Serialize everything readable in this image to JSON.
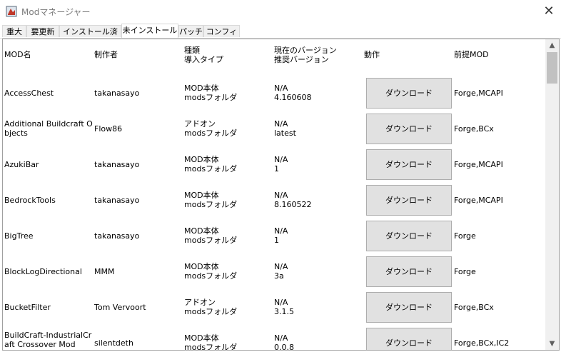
{
  "window": {
    "title": "Modマネージャー",
    "close_symbol": "✕"
  },
  "tabs": [
    {
      "label": "重大"
    },
    {
      "label": "要更新"
    },
    {
      "label": "インストール済み"
    },
    {
      "label": "未インストール",
      "active": true
    },
    {
      "label": "パッチ"
    },
    {
      "label": "コンフィグ"
    }
  ],
  "table": {
    "headers": {
      "name": "MOD名",
      "author": "制作者",
      "kind_line1": "種類",
      "kind_line2": "導入タイプ",
      "version_line1": "現在のバージョン",
      "version_line2": "推奨バージョン",
      "action": "動作",
      "prereq": "前提MOD"
    },
    "rows": [
      {
        "name": "AccessChest",
        "author": "takanasayo",
        "kind": "MOD本体",
        "install": "modsフォルダ",
        "current": "N/A",
        "recommended": "4.160608",
        "button": "ダウンロード",
        "prereq": "Forge,MCAPI"
      },
      {
        "name": "Additional Buildcraft Objects",
        "author": "Flow86",
        "kind": "アドオン",
        "install": "modsフォルダ",
        "current": "N/A",
        "recommended": "latest",
        "button": "ダウンロード",
        "prereq": "Forge,BCx"
      },
      {
        "name": "AzukiBar",
        "author": "takanasayo",
        "kind": "MOD本体",
        "install": "modsフォルダ",
        "current": "N/A",
        "recommended": "1",
        "button": "ダウンロード",
        "prereq": "Forge,MCAPI"
      },
      {
        "name": "BedrockTools",
        "author": "takanasayo",
        "kind": "MOD本体",
        "install": "modsフォルダ",
        "current": "N/A",
        "recommended": "8.160522",
        "button": "ダウンロード",
        "prereq": "Forge,MCAPI"
      },
      {
        "name": "BigTree",
        "author": "takanasayo",
        "kind": "MOD本体",
        "install": "modsフォルダ",
        "current": "N/A",
        "recommended": "1",
        "button": "ダウンロード",
        "prereq": "Forge"
      },
      {
        "name": "BlockLogDirectional",
        "author": "MMM",
        "kind": "MOD本体",
        "install": "modsフォルダ",
        "current": "N/A",
        "recommended": "3a",
        "button": "ダウンロード",
        "prereq": "Forge"
      },
      {
        "name": "BucketFilter",
        "author": "Tom Vervoort",
        "kind": "アドオン",
        "install": "modsフォルダ",
        "current": "N/A",
        "recommended": "3.1.5",
        "button": "ダウンロード",
        "prereq": "Forge,BCx"
      },
      {
        "name": "BuildCraft-IndustrialCraft Crossover Mod",
        "author": "silentdeth",
        "kind": "MOD本体",
        "install": "modsフォルダ",
        "current": "N/A",
        "recommended": "0.0.8",
        "button": "ダウンロード",
        "prereq": "Forge,BCx,IC2"
      }
    ]
  },
  "scrollbar": {
    "up_symbol": "▲",
    "down_symbol": "▼"
  }
}
